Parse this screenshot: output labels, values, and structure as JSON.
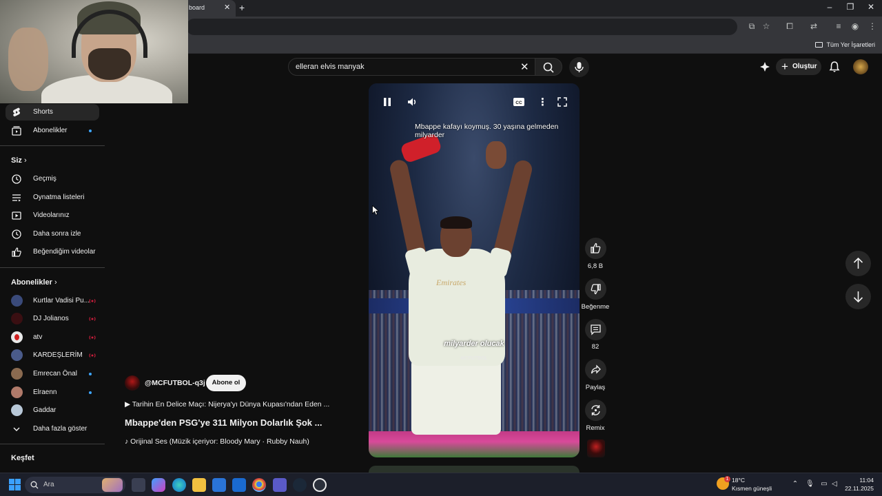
{
  "browser": {
    "tab_title": "board",
    "bookmarks_all": "Tüm Yer İşaretleri"
  },
  "search": {
    "query": "elleran elvis manyak"
  },
  "header": {
    "create_label": "Oluştur"
  },
  "sidebar": {
    "shorts_label": "Shorts",
    "subscriptions_label": "Abonelikler",
    "you_heading": "Siz",
    "you_items": [
      {
        "label": "Geçmiş",
        "icon": "history-icon"
      },
      {
        "label": "Oynatma listeleri",
        "icon": "playlists-icon"
      },
      {
        "label": "Videolarınız",
        "icon": "your-videos-icon"
      },
      {
        "label": "Daha sonra izle",
        "icon": "watch-later-icon"
      },
      {
        "label": "Beğendiğim videolar",
        "icon": "liked-videos-icon"
      }
    ],
    "subs_heading": "Abonelikler",
    "channels": [
      {
        "label": "Kurtlar Vadisi Pu...",
        "status": "live",
        "avatar_color": "#3a4a7a"
      },
      {
        "label": "DJ Jolianos",
        "status": "live",
        "avatar_color": "#3a0f12"
      },
      {
        "label": "atv",
        "status": "live",
        "avatar_color": "#e8e8e8"
      },
      {
        "label": "KARDEŞLERİM",
        "status": "live",
        "avatar_color": "#4a5b8a"
      },
      {
        "label": "Emrecan Önal",
        "status": "new",
        "avatar_color": "#8a6a50"
      },
      {
        "label": "Elraenn",
        "status": "new",
        "avatar_color": "#b07a6a"
      },
      {
        "label": "Gaddar",
        "status": "none",
        "avatar_color": "#b8c8d8"
      }
    ],
    "show_more": "Daha fazla göster",
    "explore_heading": "Keşfet"
  },
  "short": {
    "title": "Mbappe kafayı koymuş. 30 yaşına gelmeden milyarder",
    "caption": "milyarder olucak",
    "watermark": "MCFUTBOL",
    "jersey_text": "Emirates"
  },
  "actions": {
    "like_count": "6,8 B",
    "dislike_label": "Beğenme",
    "comment_count": "82",
    "share_label": "Paylaş",
    "remix_label": "Remix"
  },
  "info": {
    "channel_handle": "@MCFUTBOL-q3j",
    "subscribe_label": "Abone ol",
    "playlist_line": "▶ Tarihin En Delice Maçı: Nijerya'yı Dünya Kupası'ndan Eden ...",
    "video_title": "Mbappe'den PSG'ye 311 Milyon Dolarlık Şok ...",
    "audio_line": "♪ Orijinal Ses (Müzik içeriyor: Bloody Mary · Rubby Nauh)"
  },
  "taskbar": {
    "search_placeholder": "Ara",
    "weather_temp": "18°C",
    "weather_desc": "Kısmen güneşli",
    "weather_badge": "1",
    "time": "11:04",
    "date": "22.11.2025"
  },
  "colors": {
    "background": "#0f0f0f",
    "accent_blue": "#3ea6ff",
    "live_red": "#cc1e3c"
  }
}
